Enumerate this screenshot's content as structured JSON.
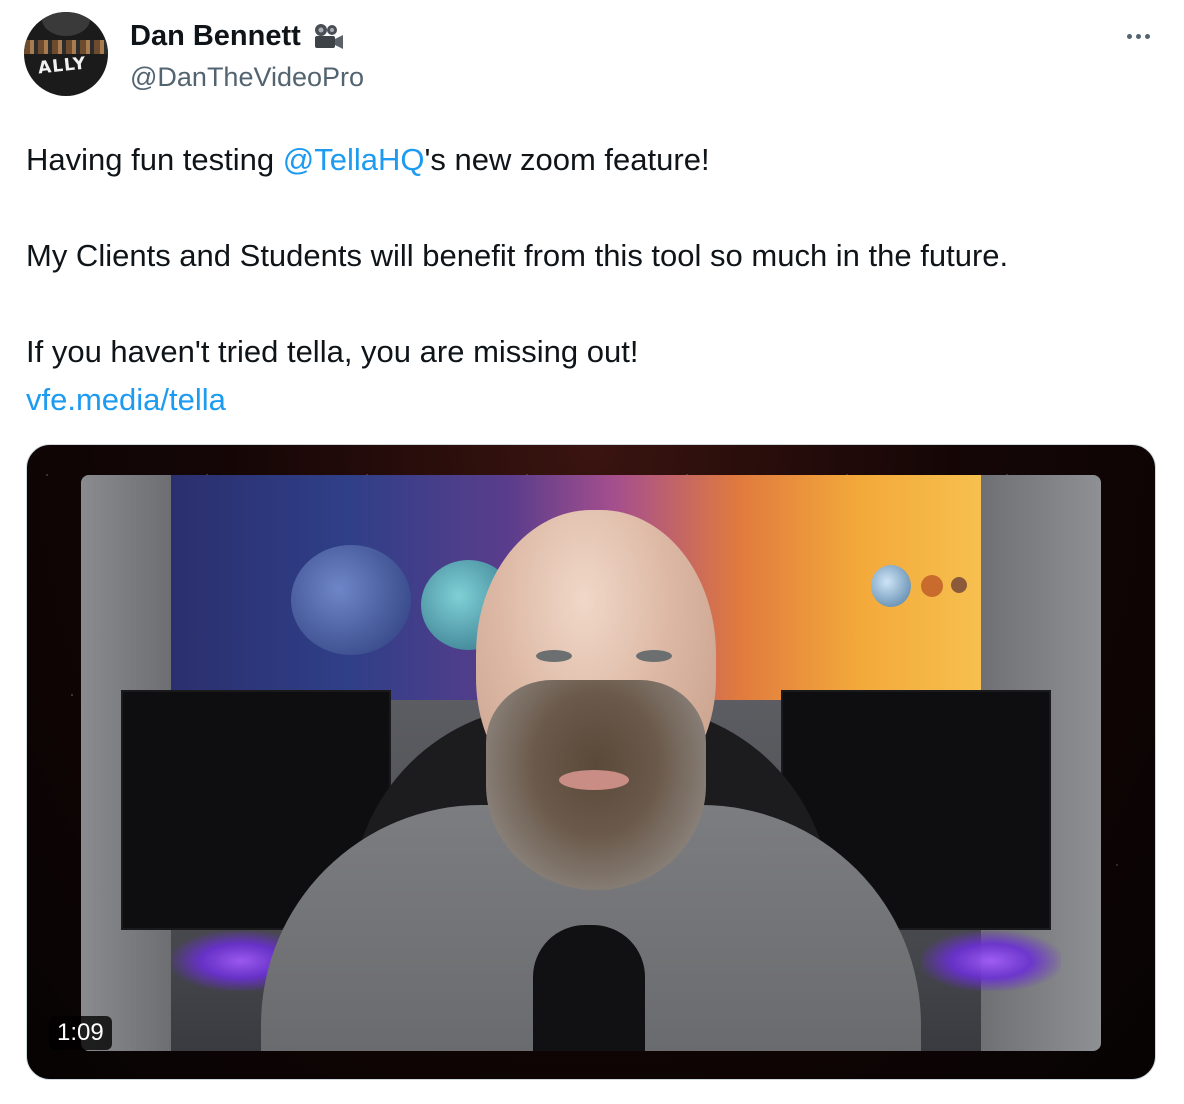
{
  "tweet": {
    "author": {
      "display_name": "Dan Bennett",
      "badge_emoji_icon": "movie-camera-icon",
      "handle": "@DanTheVideoPro",
      "avatar_text": "ALLY"
    },
    "more_label": "More",
    "text": {
      "line1_prefix": "Having fun testing ",
      "mention": "@TellaHQ",
      "line1_suffix": "'s new zoom feature!",
      "line2": "My Clients and Students will benefit from this tool so much in the future.",
      "line3": "If you haven't tried tella, you are missing out!",
      "link": "vfe.media/tella"
    },
    "media": {
      "type": "video",
      "duration": "1:09"
    }
  },
  "colors": {
    "link": "#1d9bf0",
    "secondary_text": "#536471",
    "primary_text": "#0f1419"
  }
}
